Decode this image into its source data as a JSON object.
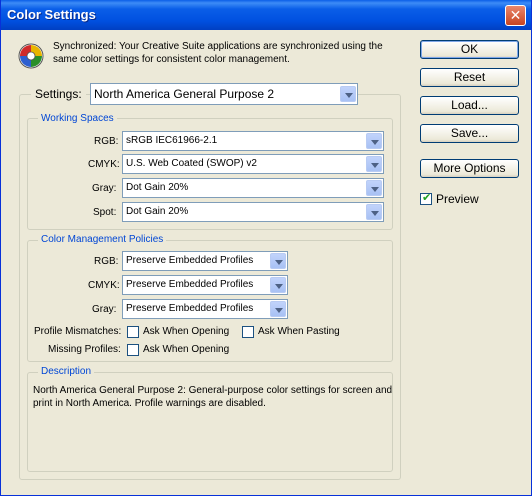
{
  "window": {
    "title": "Color Settings",
    "close_glyph": "✕"
  },
  "sync": {
    "icon": "color-wheel-icon",
    "text": "Synchronized: Your Creative Suite applications are synchronized using the same color settings for consistent color management."
  },
  "settings": {
    "label": "Settings:",
    "value": "North America General Purpose 2"
  },
  "working_spaces": {
    "title": "Working Spaces",
    "rgb": {
      "label": "RGB:",
      "value": "sRGB IEC61966-2.1"
    },
    "cmyk": {
      "label": "CMYK:",
      "value": "U.S. Web Coated (SWOP) v2"
    },
    "gray": {
      "label": "Gray:",
      "value": "Dot Gain 20%"
    },
    "spot": {
      "label": "Spot:",
      "value": "Dot Gain 20%"
    }
  },
  "policies": {
    "title": "Color Management Policies",
    "rgb": {
      "label": "RGB:",
      "value": "Preserve Embedded Profiles"
    },
    "cmyk": {
      "label": "CMYK:",
      "value": "Preserve Embedded Profiles"
    },
    "gray": {
      "label": "Gray:",
      "value": "Preserve Embedded Profiles"
    },
    "profile_mismatches": {
      "label": "Profile Mismatches:",
      "ask_opening": {
        "label": "Ask When Opening",
        "checked": false
      },
      "ask_pasting": {
        "label": "Ask When Pasting",
        "checked": false
      }
    },
    "missing_profiles": {
      "label": "Missing Profiles:",
      "ask_opening": {
        "label": "Ask When Opening",
        "checked": false
      }
    }
  },
  "description": {
    "title": "Description",
    "text": "North America General Purpose 2:  General-purpose color settings for screen and print in North America. Profile warnings are disabled."
  },
  "buttons": {
    "ok": "OK",
    "reset": "Reset",
    "load": "Load...",
    "save": "Save...",
    "more_options": "More Options"
  },
  "preview": {
    "label": "Preview",
    "checked": true
  },
  "colors": {
    "title_bar": "#0050e0",
    "group_title": "#0046d5",
    "dialog_bg": "#ece9d8"
  }
}
